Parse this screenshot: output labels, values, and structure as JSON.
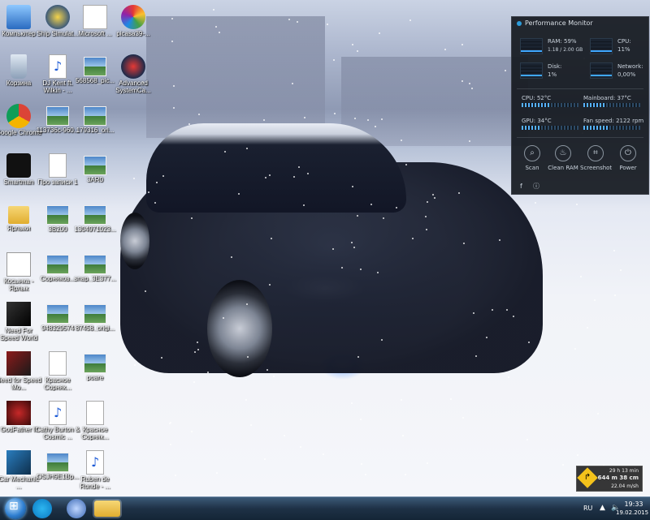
{
  "desktop": {
    "icons": [
      {
        "label": "Компьютер",
        "icon": "computer-icon"
      },
      {
        "label": "Ship Simulat...",
        "icon": "ship-simulator-icon"
      },
      {
        "label": "Microsoft ...",
        "icon": "torrent-icon"
      },
      {
        "label": "picasa39-...",
        "icon": "picasa-icon"
      },
      {
        "label": "Корзина",
        "icon": "recycle-bin-icon"
      },
      {
        "label": "DJ Kent ft. Wilkin - ...",
        "icon": "audio-file-icon"
      },
      {
        "label": "568568_pic...",
        "icon": "image-file-icon"
      },
      {
        "label": "Advanced SystemCa...",
        "icon": "advanced-systemcare-icon"
      },
      {
        "label": "Google Chrome",
        "icon": "chrome-icon"
      },
      {
        "label": "113736c-960...",
        "icon": "image-file-icon"
      },
      {
        "label": "179316_ori...",
        "icon": "image-file-icon"
      },
      {
        "label": "Smartman",
        "icon": "smartman-icon"
      },
      {
        "label": "Про записи 1",
        "icon": "document-icon"
      },
      {
        "label": "3AR0",
        "icon": "image-file-icon"
      },
      {
        "label": "Ярлыки",
        "icon": "folder-icon"
      },
      {
        "label": "3B200",
        "icon": "image-file-icon"
      },
      {
        "label": "1304971023...",
        "icon": "image-file-icon"
      },
      {
        "label": "Косынка - Ярлык",
        "icon": "solitaire-icon"
      },
      {
        "label": "Сорняков...",
        "icon": "image-file-icon"
      },
      {
        "label": "snap_3E377...",
        "icon": "image-file-icon"
      },
      {
        "label": "Need For Speed World",
        "icon": "nfs-world-icon"
      },
      {
        "label": "948329574",
        "icon": "image-file-icon"
      },
      {
        "label": "87458_origi...",
        "icon": "image-file-icon"
      },
      {
        "label": "Need for Speed Mo...",
        "icon": "nfs-most-wanted-icon"
      },
      {
        "label": "Красное Сорняк...",
        "icon": "document-icon"
      },
      {
        "label": "роаrе",
        "icon": "image-file-icon"
      },
      {
        "label": "GodFather II",
        "icon": "godfather-icon"
      },
      {
        "label": "Cathy Burton & Cosmic ...",
        "icon": "audio-file-icon"
      },
      {
        "label": "Красное Сорняк...",
        "icon": "document-icon"
      },
      {
        "label": "Car Mechanic ...",
        "icon": "car-mechanic-icon"
      },
      {
        "label": "OSJH9E1Bp...",
        "icon": "image-file-icon"
      },
      {
        "label": "Ruben de Ronde - ...",
        "icon": "audio-file-icon"
      }
    ]
  },
  "perf": {
    "title": "Performance Monitor",
    "ram_label": "RAM: 59%",
    "ram_sub": "1.18 / 2.00 GB",
    "cpu_label": "CPU:",
    "cpu_value": "11%",
    "disk_label": "Disk:",
    "disk_value": "1%",
    "net_label": "Network:",
    "net_value": "0,00%",
    "cpu_temp": "CPU:  52°C",
    "mb_temp": "Mainboard:  37°C",
    "gpu_temp": "GPU:  34°C",
    "fan": "Fan speed:  2122 rpm",
    "cpu_temp_level": 0.52,
    "mb_temp_level": 0.37,
    "gpu_temp_level": 0.34,
    "fan_level": 0.45,
    "buttons": [
      "Scan",
      "Clean RAM",
      "Screenshot",
      "Power"
    ]
  },
  "speed_widget": {
    "time": "29 h 13 min",
    "distance": "644 m 38 cm",
    "speed": "22.04 m/sh"
  },
  "taskbar": {
    "lang": "RU",
    "time": "19:33",
    "date": "19.02.2015"
  },
  "colors": {
    "accent": "#3fa7ff",
    "taskbar": "#1e3146"
  }
}
